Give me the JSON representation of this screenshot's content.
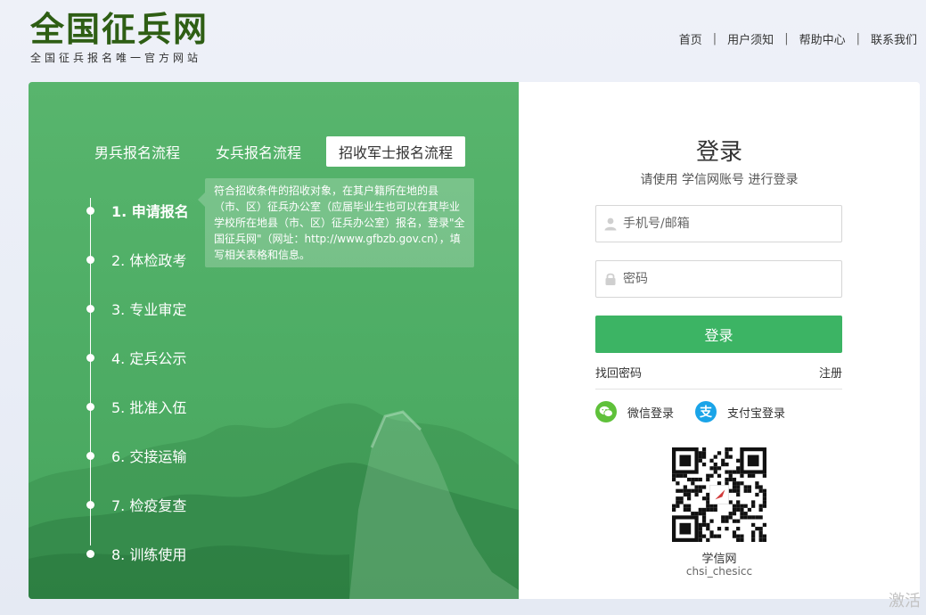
{
  "header": {
    "logo_title": "全国征兵网",
    "logo_subtitle": "全国征兵报名唯一官方网站",
    "nav": [
      "首页",
      "用户须知",
      "帮助中心",
      "联系我们"
    ]
  },
  "process": {
    "tabs": [
      "男兵报名流程",
      "女兵报名流程",
      "招收军士报名流程"
    ],
    "active_tab": 2,
    "steps": [
      "1. 申请报名",
      "2. 体检政考",
      "3. 专业审定",
      "4. 定兵公示",
      "5. 批准入伍",
      "6. 交接运输",
      "7. 检疫复查",
      "8. 训练使用"
    ],
    "tooltip": "符合招收条件的招收对象，在其户籍所在地的县（市、区）征兵办公室（应届毕业生也可以在其毕业学校所在地县（市、区）征兵办公室）报名，登录\"全国征兵网\"（网址：http://www.gfbzb.gov.cn），填写相关表格和信息。"
  },
  "login": {
    "title": "登录",
    "hint": "请使用  学信网账号  进行登录",
    "username_placeholder": "手机号/邮箱",
    "password_placeholder": "密码",
    "submit_label": "登录",
    "forgot_label": "找回密码",
    "register_label": "注册",
    "wechat_label": "微信登录",
    "alipay_label": "支付宝登录",
    "qr_label": "学信网",
    "qr_sub": "chsi_chesicc"
  },
  "watermark": "激活",
  "colors": {
    "logo_green": "#2e5e14",
    "panel_green": "#4fae66",
    "button_green": "#3cb464",
    "wechat_green": "#5fc13a",
    "alipay_blue": "#1aa4e8"
  }
}
